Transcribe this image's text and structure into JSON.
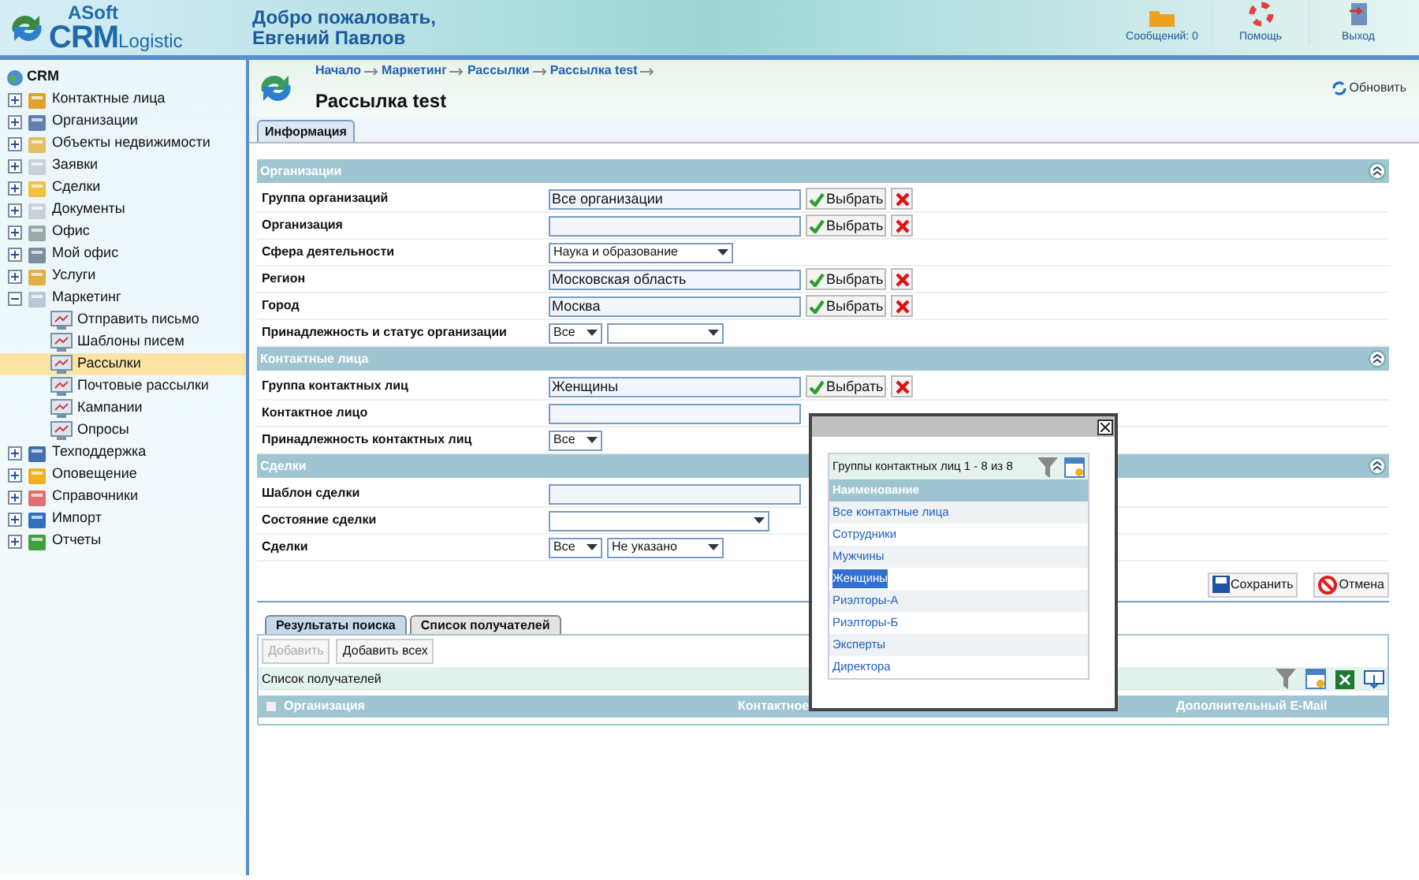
{
  "header": {
    "logo": {
      "top": "ASoft",
      "main": "CRM",
      "sub": "Logistic"
    },
    "welcome": [
      "Добро пожаловать,",
      "Евгений Павлов"
    ],
    "actions": [
      {
        "kind": "messages",
        "label": "Сообщений: 0"
      },
      {
        "kind": "help",
        "label": "Помощь"
      },
      {
        "kind": "exit",
        "label": "Выход"
      }
    ]
  },
  "sidebar": {
    "root": "CRM",
    "items": [
      {
        "label": "Контактные лица",
        "expanded": false,
        "selected": false
      },
      {
        "label": "Организации",
        "expanded": false,
        "selected": false
      },
      {
        "label": "Объекты недвижимости",
        "expanded": false,
        "selected": false
      },
      {
        "label": "Заявки",
        "expanded": false,
        "selected": false
      },
      {
        "label": "Сделки",
        "expanded": false,
        "selected": false
      },
      {
        "label": "Документы",
        "expanded": false,
        "selected": false
      },
      {
        "label": "Офис",
        "expanded": false,
        "selected": false
      },
      {
        "label": "Мой офис",
        "expanded": false,
        "selected": false
      },
      {
        "label": "Услуги",
        "expanded": false,
        "selected": false
      },
      {
        "label": "Маркетинг",
        "expanded": true,
        "selected": false,
        "children": [
          {
            "label": "Отправить письмо",
            "selected": false
          },
          {
            "label": "Шаблоны писем",
            "selected": false
          },
          {
            "label": "Рассылки",
            "selected": true
          },
          {
            "label": "Почтовые рассылки",
            "selected": false
          },
          {
            "label": "Кампании",
            "selected": false
          },
          {
            "label": "Опросы",
            "selected": false
          }
        ]
      },
      {
        "label": "Техподдержка",
        "expanded": false,
        "selected": false
      },
      {
        "label": "Оповещение",
        "expanded": false,
        "selected": false
      },
      {
        "label": "Справочники",
        "expanded": false,
        "selected": false
      },
      {
        "label": "Импорт",
        "expanded": false,
        "selected": false
      },
      {
        "label": "Отчеты",
        "expanded": false,
        "selected": false
      }
    ]
  },
  "breadcrumb": [
    "Начало",
    "Маркетинг",
    "Рассылки",
    "Рассылка test"
  ],
  "title": "Рассылка test",
  "refresh": "Обновить",
  "tabs": [
    {
      "label": "Информация",
      "selected": true
    }
  ],
  "sections": [
    {
      "title": "Организации",
      "rows": [
        {
          "label": "Группа организаций",
          "controls": [
            {
              "kind": "input",
              "value": "Все организации",
              "button": "Выбрать"
            }
          ]
        },
        {
          "label": "Организация",
          "controls": [
            {
              "kind": "input",
              "button": "Выбрать"
            }
          ]
        },
        {
          "label": "Сфера деятельности",
          "controls": [
            {
              "kind": "long-select",
              "value": "Наука и образование"
            }
          ]
        },
        {
          "label": "Регион",
          "controls": [
            {
              "kind": "input",
              "value": "Московская область",
              "button": "Выбрать"
            }
          ]
        },
        {
          "label": "Город",
          "controls": [
            {
              "kind": "input",
              "value": "Москва",
              "button": "Выбрать"
            }
          ]
        },
        {
          "label": "Принадлежность и статус организации",
          "controls": [
            {
              "kind": "short-select",
              "value": "Все"
            },
            {
              "kind": "select"
            }
          ]
        }
      ]
    },
    {
      "title": "Контактные лица",
      "rows": [
        {
          "label": "Группа контактных лиц",
          "controls": [
            {
              "kind": "input",
              "value": "Женщины",
              "button": "Выбрать"
            }
          ]
        },
        {
          "label": "Контактное лицо",
          "controls": [
            {
              "kind": "input"
            }
          ]
        },
        {
          "label": "Принадлежность контактных лиц",
          "controls": [
            {
              "kind": "short-select",
              "value": "Все"
            }
          ]
        }
      ]
    },
    {
      "title": "Сделки",
      "rows": [
        {
          "label": "Шаблон сделки",
          "controls": [
            {
              "kind": "input"
            }
          ]
        },
        {
          "label": "Состояние сделки",
          "controls": [
            {
              "kind": "wide-select"
            }
          ]
        },
        {
          "label": "Сделки",
          "controls": [
            {
              "kind": "short-select",
              "value": "Все"
            },
            {
              "kind": "select",
              "value": "Не указано"
            }
          ]
        }
      ]
    }
  ],
  "actions": [
    {
      "kind": "save",
      "label": "Сохранить"
    },
    {
      "kind": "cancel",
      "label": "Отмена"
    }
  ],
  "bottom_tabs": [
    {
      "label": "Результаты поиска",
      "selected": true
    },
    {
      "label": "Список получателей",
      "selected": false
    }
  ],
  "bottom_buttons": [
    {
      "label": "Добавить",
      "disabled": true
    },
    {
      "label": "Добавить всех",
      "disabled": false
    }
  ],
  "grid": {
    "caption": "Список получателей",
    "select_all_checked": false,
    "columns": [
      "Организация",
      "Контактное",
      "Дополнительный E-Mail"
    ]
  },
  "popup": {
    "caption": "Группы контактных лиц 1 - 8 из 8",
    "column": "Наименование",
    "rows": [
      {
        "label": "Все контактные лица",
        "selected": false
      },
      {
        "label": "Сотрудники",
        "selected": false
      },
      {
        "label": "Мужчины",
        "selected": false
      },
      {
        "label": "Женщины",
        "selected": true
      },
      {
        "label": "Риэлторы-А",
        "selected": false
      },
      {
        "label": "Риэлторы-Б",
        "selected": false
      },
      {
        "label": "Эксперты",
        "selected": false
      },
      {
        "label": "Директора",
        "selected": false
      }
    ]
  }
}
